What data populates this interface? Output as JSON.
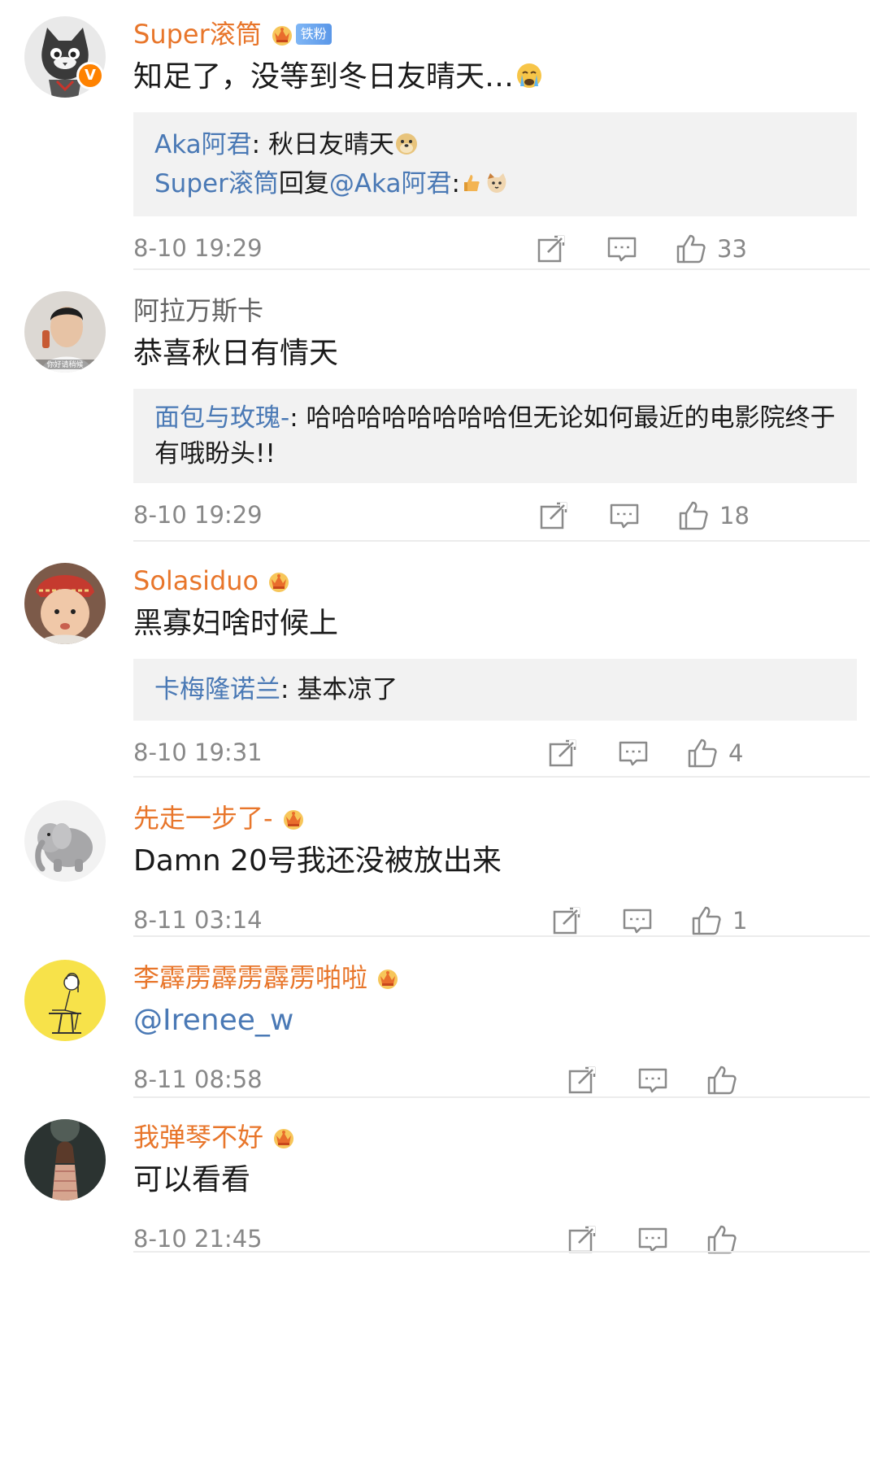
{
  "comments": [
    {
      "name": "Super滚筒",
      "badge_text": "铁粉",
      "text": "知足了，没等到冬日友晴天…",
      "replies": [
        {
          "name": "Aka阿君",
          "sep": ": ",
          "text": "秋日友晴天"
        },
        {
          "name": "Super滚筒",
          "mid": "回复",
          "at": "@Aka阿君",
          "sep": ":"
        }
      ],
      "time": "8-10 19:29",
      "likes": "33"
    },
    {
      "name": "阿拉万斯卡",
      "text": "恭喜秋日有情天",
      "avatar_caption": "你好请稍候",
      "replies": [
        {
          "name": "面包与玫瑰-",
          "sep": ": ",
          "text": "哈哈哈哈哈哈哈哈但无论如何最近的电影院终于有哦盼头!!"
        }
      ],
      "time": "8-10 19:29",
      "likes": "18"
    },
    {
      "name": "Solasiduo",
      "text": "黑寡妇啥时候上",
      "replies": [
        {
          "name": "卡梅隆诺兰",
          "sep": ": ",
          "text": "基本凉了"
        }
      ],
      "time": "8-10 19:31",
      "likes": "4"
    },
    {
      "name": "先走一步了-",
      "text": "Damn 20号我还没被放出来",
      "time": "8-11 03:14",
      "likes": "1"
    },
    {
      "name": "李霹雳霹雳霹雳啪啦",
      "text": "@Irenee_w",
      "time": "8-11 08:58",
      "likes": ""
    },
    {
      "name": "我弹琴不好",
      "text": "可以看看",
      "time": "8-10 21:45",
      "likes": ""
    }
  ],
  "icons": {
    "repost": "repost-icon",
    "comment": "comment-icon",
    "like": "thumbs-up-icon",
    "crown": "crown-icon"
  },
  "colors": {
    "vip_name": "#e8762b",
    "reply_name": "#4a79b5",
    "reply_bg": "#f2f2f2",
    "verified": "#ff8200"
  }
}
